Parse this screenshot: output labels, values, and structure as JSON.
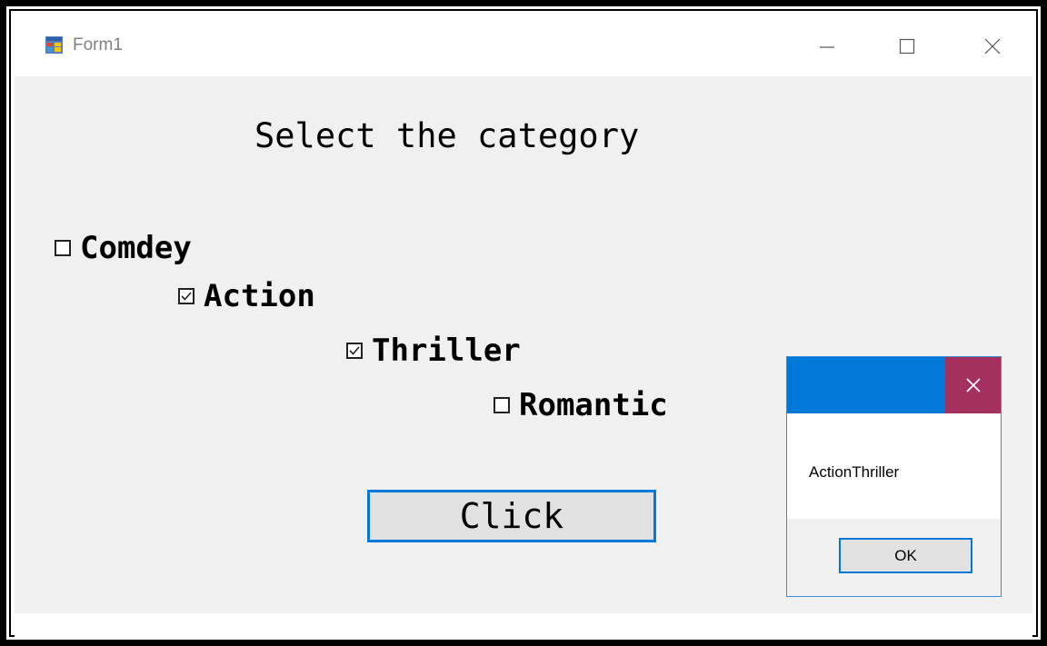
{
  "window": {
    "title": "Form1",
    "controls": {
      "minimize_icon": "minimize-icon",
      "maximize_icon": "maximize-icon",
      "close_icon": "close-icon"
    }
  },
  "form": {
    "heading": "Select the category",
    "checkboxes": [
      {
        "label": "Comdey",
        "checked": false
      },
      {
        "label": "Action",
        "checked": true
      },
      {
        "label": "Thriller",
        "checked": true
      },
      {
        "label": "Romantic",
        "checked": false
      }
    ],
    "button_label": "Click"
  },
  "message_box": {
    "text": "ActionThriller",
    "ok_label": "OK",
    "colors": {
      "titlebar": "#0078d7",
      "close": "#a4305e"
    }
  }
}
